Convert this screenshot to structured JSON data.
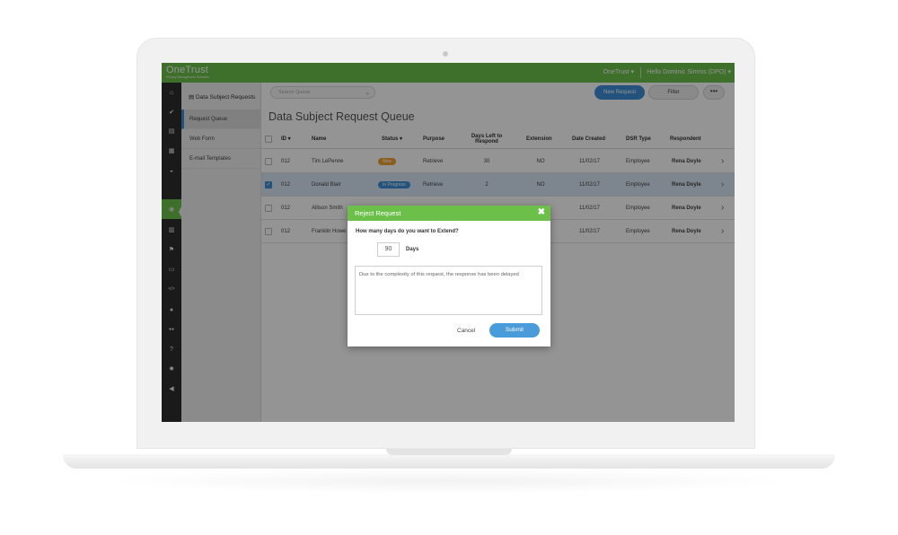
{
  "brand": {
    "name": "OneTrust",
    "tagline": "Privacy Management Software"
  },
  "topbar": {
    "org": "OneTrust ▾",
    "user": "Hello Dominic Simms (DPO) ▾"
  },
  "iconbar": [
    {
      "icon": "home-icon",
      "glyph": "⌂"
    },
    {
      "icon": "check-icon",
      "glyph": "✔"
    },
    {
      "icon": "document-icon",
      "glyph": "▤"
    },
    {
      "icon": "grid-icon",
      "glyph": "▦"
    },
    {
      "icon": "dashboard-icon",
      "glyph": "◒"
    },
    {
      "icon": "subject-request-icon",
      "glyph": "◉"
    },
    {
      "icon": "table-icon",
      "glyph": "▥"
    },
    {
      "icon": "flag-icon",
      "glyph": "⚑"
    },
    {
      "icon": "folder-icon",
      "glyph": "▭"
    },
    {
      "icon": "code-icon",
      "glyph": "</>"
    },
    {
      "icon": "user-icon",
      "glyph": "●"
    },
    {
      "icon": "users-icon",
      "glyph": "●●"
    },
    {
      "icon": "help-icon",
      "glyph": "?"
    },
    {
      "icon": "settings-icon",
      "glyph": "✹"
    },
    {
      "icon": "megaphone-icon",
      "glyph": "◀"
    }
  ],
  "subnav": {
    "title": "Data Subject Requests",
    "items": [
      {
        "label": "Request Queue"
      },
      {
        "label": "Web Form"
      },
      {
        "label": "E-mail Templates"
      }
    ]
  },
  "toolbar": {
    "search_placeholder": "Search Queue",
    "new_request": "New Request",
    "filter": "Filter",
    "more": "•••"
  },
  "page_title": "Data Subject Request Queue",
  "table": {
    "headers": {
      "id": "ID ▾",
      "name": "Name",
      "status": "Status ▾",
      "purpose": "Purpose",
      "days_left": "Days Left to Respond",
      "extension": "Extension",
      "date_created": "Date Created",
      "dsr_type": "DSR Type",
      "respondent": "Respondent"
    },
    "rows": [
      {
        "id": "012",
        "name": "Tim LePenne",
        "status": "New",
        "purpose": "Retrieve",
        "days_left": "30",
        "extension": "NO",
        "date_created": "11/02/17",
        "dsr_type": "Employee",
        "respondent": "Rena Doyle"
      },
      {
        "id": "012",
        "name": "Donald Blair",
        "status": "In Progress",
        "purpose": "Retrieve",
        "days_left": "2",
        "extension": "NO",
        "date_created": "11/02/17",
        "dsr_type": "Employee",
        "respondent": "Rena Doyle"
      },
      {
        "id": "012",
        "name": "Allison Smith",
        "status": "",
        "purpose": "",
        "days_left": "",
        "extension": "",
        "date_created": "11/02/17",
        "dsr_type": "Employee",
        "respondent": "Rena Doyle"
      },
      {
        "id": "012",
        "name": "Franklin Howe",
        "status": "",
        "purpose": "",
        "days_left": "",
        "extension": "",
        "date_created": "11/02/17",
        "dsr_type": "Employee",
        "respondent": "Rena Doyle"
      }
    ]
  },
  "modal": {
    "title": "Reject Request",
    "close": "✖",
    "question": "How many days do you want to Extend?",
    "days_value": "90",
    "days_label": "Days",
    "reason_text": "Due to the complexity of this request, the response has been delayed",
    "cancel": "Cancel",
    "submit": "Submit"
  }
}
